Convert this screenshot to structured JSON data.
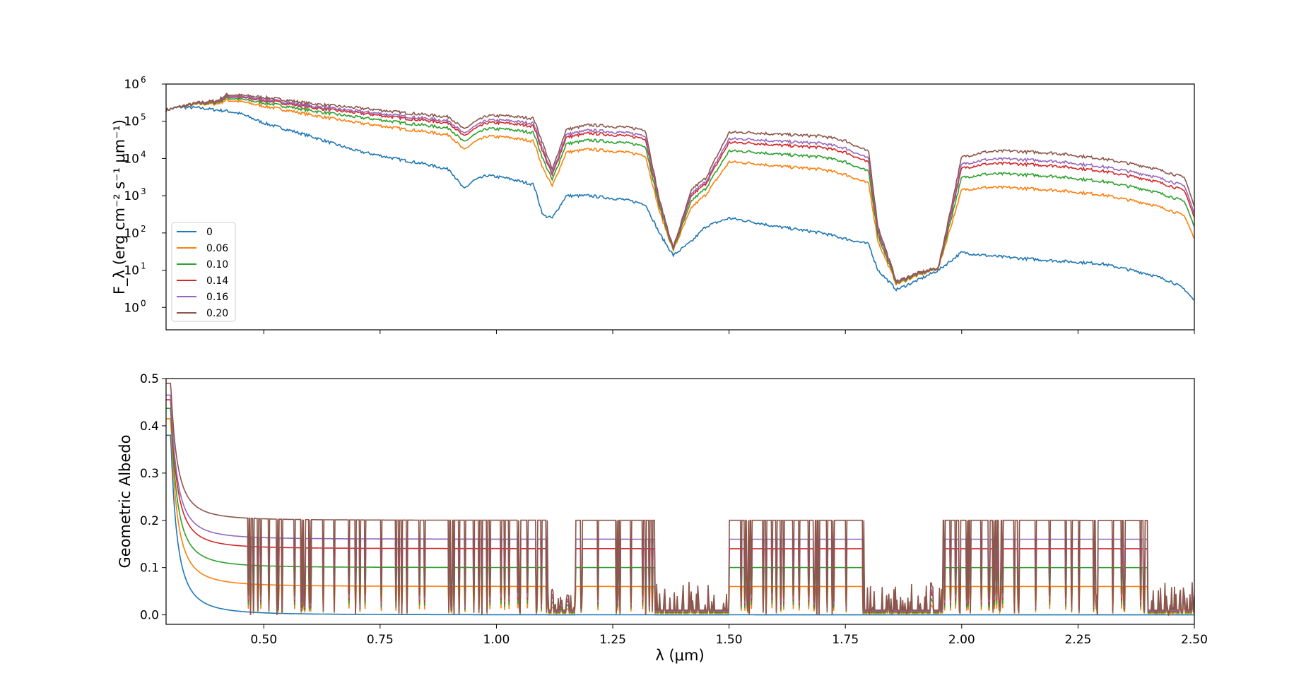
{
  "chart_data": [
    {
      "type": "line",
      "panel": "top",
      "title": "",
      "ylabel": "F_λ (erg cm⁻² s⁻¹ μm⁻¹)",
      "xlabel": "",
      "yscale": "log",
      "ylim": [
        0.25,
        1000000
      ],
      "xlim": [
        0.29,
        2.5
      ],
      "yticks": [
        {
          "value": 1,
          "base": "10",
          "exp": "0"
        },
        {
          "value": 10,
          "base": "10",
          "exp": "1"
        },
        {
          "value": 100,
          "base": "10",
          "exp": "2"
        },
        {
          "value": 1000,
          "base": "10",
          "exp": "3"
        },
        {
          "value": 10000,
          "base": "10",
          "exp": "4"
        },
        {
          "value": 100000,
          "base": "10",
          "exp": "5"
        },
        {
          "value": 1000000,
          "base": "10",
          "exp": "6"
        }
      ],
      "legend": {
        "placement": "lower-left",
        "entries": [
          "0",
          "0.06",
          "0.10",
          "0.14",
          "0.16",
          "0.20"
        ]
      },
      "grid": false,
      "series": [
        {
          "name": "0",
          "color": "#1f77b4",
          "scale": 0.0
        },
        {
          "name": "0.06",
          "color": "#ff7f0e",
          "scale": 0.3
        },
        {
          "name": "0.10",
          "color": "#2ca02c",
          "scale": 0.5
        },
        {
          "name": "0.14",
          "color": "#d62728",
          "scale": 0.7
        },
        {
          "name": "0.16",
          "color": "#9467bd",
          "scale": 0.8
        },
        {
          "name": "0.20",
          "color": "#8c564b",
          "scale": 1.0
        }
      ],
      "continuum": {
        "x": [
          0.29,
          0.32,
          0.36,
          0.4,
          0.42,
          0.45,
          0.5,
          0.55,
          0.6,
          0.65,
          0.7,
          0.75,
          0.8,
          0.85,
          0.9,
          0.93,
          0.95,
          0.98,
          1.02,
          1.08,
          1.1,
          1.12,
          1.15,
          1.2,
          1.27,
          1.32,
          1.35,
          1.38,
          1.42,
          1.45,
          1.5,
          1.55,
          1.6,
          1.7,
          1.75,
          1.8,
          1.82,
          1.86,
          1.9,
          1.95,
          2.0,
          2.05,
          2.1,
          2.2,
          2.3,
          2.4,
          2.45,
          2.48,
          2.5
        ],
        "upper": [
          200000,
          250000,
          320000,
          360000,
          520000,
          500000,
          440000,
          370000,
          300000,
          260000,
          230000,
          200000,
          170000,
          150000,
          130000,
          60000,
          90000,
          140000,
          140000,
          120000,
          25000,
          5000,
          60000,
          80000,
          70000,
          60000,
          800,
          40,
          1500,
          3000,
          50000,
          50000,
          45000,
          40000,
          30000,
          15000,
          150,
          5,
          8,
          12,
          11000,
          15000,
          16000,
          14000,
          10000,
          6000,
          4000,
          3000,
          500
        ],
        "lower0": [
          200000,
          240000,
          230000,
          200000,
          190000,
          160000,
          90000,
          60000,
          40000,
          25000,
          16000,
          12000,
          9000,
          7000,
          5000,
          1500,
          2500,
          3500,
          3000,
          2000,
          300,
          250,
          1000,
          1000,
          800,
          600,
          100,
          25,
          60,
          150,
          250,
          200,
          150,
          100,
          70,
          50,
          10,
          3,
          5,
          10,
          30,
          25,
          22,
          18,
          15,
          8,
          5,
          3,
          1.5
        ]
      }
    },
    {
      "type": "line",
      "panel": "bottom",
      "title": "",
      "ylabel": "Geometric Albedo",
      "xlabel": "λ (μm)",
      "ylim": [
        -0.02,
        0.5
      ],
      "xlim": [
        0.29,
        2.5
      ],
      "yticks": [
        "0.0",
        "0.1",
        "0.2",
        "0.3",
        "0.4",
        "0.5"
      ],
      "xticks": [
        "0.50",
        "0.75",
        "1.00",
        "1.25",
        "1.50",
        "1.75",
        "2.00",
        "2.25",
        "2.50"
      ],
      "grid": false,
      "series": [
        {
          "name": "0",
          "color": "#1f77b4",
          "start_value": 0.38,
          "plateau": 0.0
        },
        {
          "name": "0.06",
          "color": "#ff7f0e",
          "start_value": 0.415,
          "plateau": 0.06
        },
        {
          "name": "0.10",
          "color": "#2ca02c",
          "start_value": 0.437,
          "plateau": 0.1
        },
        {
          "name": "0.14",
          "color": "#d62728",
          "start_value": 0.455,
          "plateau": 0.14
        },
        {
          "name": "0.16",
          "color": "#9467bd",
          "start_value": 0.465,
          "plateau": 0.16
        },
        {
          "name": "0.20",
          "color": "#8c564b",
          "start_value": 0.49,
          "plateau": 0.2
        }
      ],
      "absorption_bands_um": [
        [
          1.11,
          1.17
        ],
        [
          1.34,
          1.5
        ],
        [
          1.79,
          1.96
        ],
        [
          2.4,
          2.5
        ]
      ]
    }
  ]
}
